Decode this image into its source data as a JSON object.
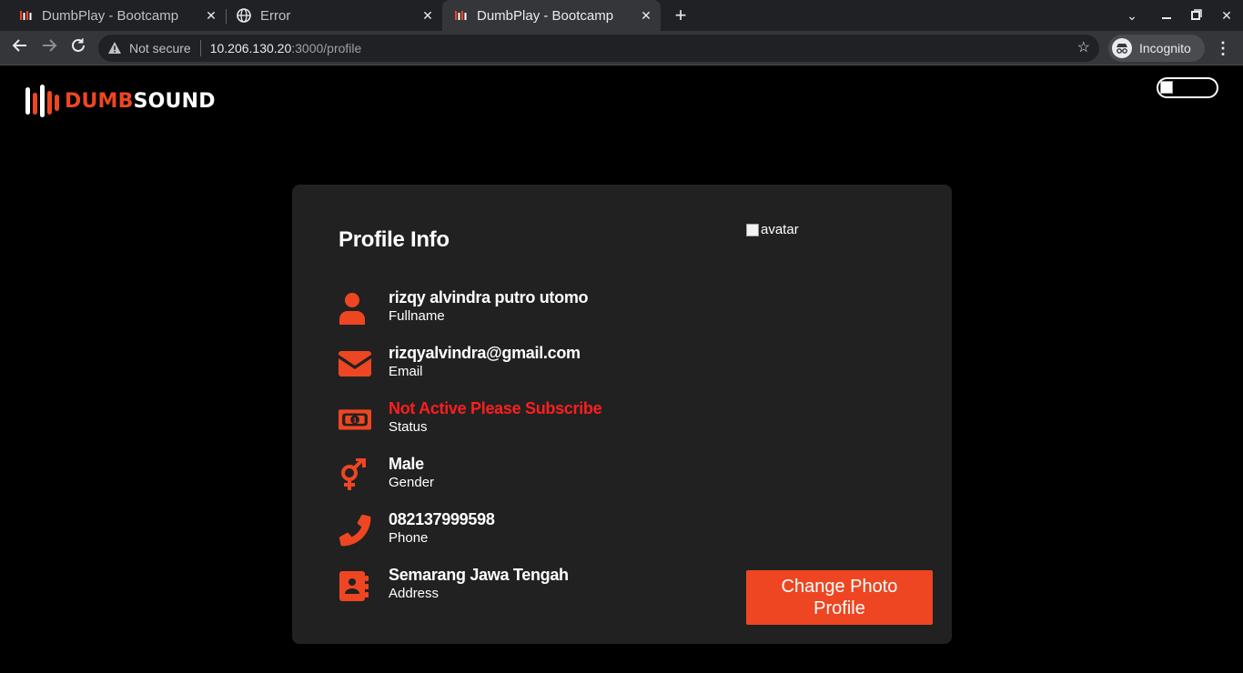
{
  "browser": {
    "tabs": [
      {
        "title": "DumbPlay - Bootcamp De",
        "active": false,
        "favicon": "dumbsound-favicon"
      },
      {
        "title": "Error",
        "active": false,
        "favicon": "globe-icon"
      },
      {
        "title": "DumbPlay - Bootcamp De",
        "active": true,
        "favicon": "dumbsound-favicon"
      }
    ],
    "address": {
      "security_text": "Not secure",
      "host": "10.206.130.20",
      "path": ":3000/profile"
    },
    "incognito_label": "Incognito"
  },
  "app": {
    "logo_prefix": "DUMB",
    "logo_suffix": "SOUND",
    "accent_color": "#ee4622"
  },
  "profile": {
    "title": "Profile Info",
    "avatar_alt": "avatar",
    "change_photo_label": "Change Photo Profile",
    "fields": [
      {
        "value": "rizqy alvindra putro utomo",
        "label": "Fullname",
        "icon": "user-icon"
      },
      {
        "value": "rizqyalvindra@gmail.com",
        "label": "Email",
        "icon": "envelope-icon"
      },
      {
        "value": "Not Active Please Subscribe",
        "label": "Status",
        "icon": "money-bill-icon",
        "color": "#ff1e1e"
      },
      {
        "value": "Male",
        "label": "Gender",
        "icon": "gender-icon"
      },
      {
        "value": "082137999598",
        "label": "Phone",
        "icon": "phone-icon"
      },
      {
        "value": "Semarang Jawa Tengah",
        "label": "Address",
        "icon": "address-book-icon"
      }
    ]
  }
}
